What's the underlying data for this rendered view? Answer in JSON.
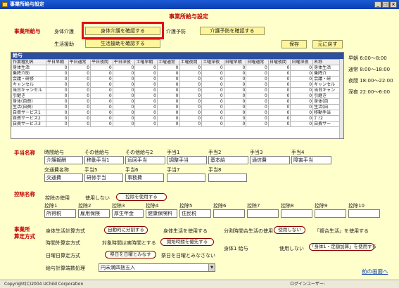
{
  "window": {
    "title": "事業所給与設定"
  },
  "page": {
    "title": "事業所給与設定"
  },
  "jigyosho_kyuyo": {
    "section_label": "事業所給与",
    "kaigo_label": "身体介護",
    "kaigo_button": "身体介護を確認する",
    "kaigo_yobo_label": "介護予防",
    "kaigo_yobo_button": "介護予防を確認する",
    "seikatsu_label": "生活援助",
    "seikatsu_button": "生活援助を確認する",
    "save_button": "保存",
    "back_button": "元に戻す"
  },
  "grid": {
    "title": "給与",
    "columns": [
      "作業種別名",
      "平日早朝",
      "平日通常",
      "平日夜間",
      "平日深夜",
      "土曜早朝",
      "土曜通常",
      "土曜夜間",
      "土曜深夜",
      "日曜早朝",
      "日曜通常",
      "日曜夜間",
      "日曜深夜",
      "名称"
    ],
    "rows": [
      {
        "label": "身体生活",
        "values": [
          0,
          0,
          0,
          0,
          0,
          0,
          0,
          0,
          0,
          0,
          0,
          0
        ],
        "name": "身体生活"
      },
      {
        "label": "乗降介助",
        "values": [
          0,
          0,
          0,
          0,
          0,
          0,
          0,
          0,
          0,
          0,
          0,
          0
        ],
        "name": "乗降介"
      },
      {
        "label": "会議・研修",
        "values": [
          0,
          0,
          0,
          0,
          0,
          0,
          0,
          0,
          0,
          0,
          0,
          0
        ],
        "name": "会議・研"
      },
      {
        "label": "キャンセル",
        "values": [
          0,
          0,
          0,
          0,
          0,
          0,
          0,
          0,
          0,
          0,
          0,
          0
        ],
        "name": "キャンセル"
      },
      {
        "label": "当日キャンセル",
        "values": [
          0,
          0,
          0,
          0,
          0,
          0,
          0,
          0,
          0,
          0,
          0,
          0
        ],
        "name": "当日キャン"
      },
      {
        "label": "引継き",
        "values": [
          0,
          0,
          0,
          0,
          0,
          0,
          0,
          0,
          0,
          0,
          0,
          0
        ],
        "name": "引継き"
      },
      {
        "label": "身体(自費)",
        "values": [
          0,
          0,
          0,
          0,
          0,
          0,
          0,
          0,
          0,
          0,
          0,
          0
        ],
        "name": "身体(自"
      },
      {
        "label": "生活(自費)",
        "values": [
          0,
          0,
          0,
          0,
          0,
          0,
          0,
          0,
          0,
          0,
          0,
          0
        ],
        "name": "生活(自"
      },
      {
        "label": "自費サービス1",
        "values": [
          0,
          0,
          0,
          0,
          0,
          0,
          0,
          0,
          0,
          0,
          0,
          0
        ],
        "name": "移動手当"
      },
      {
        "label": "自費サービス2",
        "values": [
          0,
          0,
          0,
          0,
          0,
          0,
          0,
          0,
          0,
          0,
          0,
          0
        ],
        "name": "ｺﾞﾐ2"
      },
      {
        "label": "自費サービス3",
        "values": [
          0,
          0,
          0,
          0,
          0,
          0,
          0,
          0,
          0,
          0,
          0,
          0
        ],
        "name": "自費サー"
      }
    ]
  },
  "time_slots": [
    "早朝 6:00～8:00",
    "通常 8:00～18:00",
    "夜間 18:00～22:00",
    "深夜 22:00～6:00"
  ],
  "teate": {
    "section_label": "手当名称",
    "labels_row1": [
      "時間給与",
      "その他給与",
      "その他給与2",
      "手当1",
      "手当2",
      "手当3",
      "手当4"
    ],
    "values_row1": [
      "介護報酬",
      "移動手当1",
      "远回手当",
      "調整手当",
      "基本給",
      "通信費",
      "障害手当"
    ],
    "labels_row2": [
      "交通費名称",
      "手当5",
      "手当6",
      "手当7",
      "手当8"
    ],
    "values_row2": [
      "交通費",
      "研修手当",
      "事務費",
      "",
      ""
    ]
  },
  "kojo": {
    "section_label": "控除名称",
    "use_label": "控除の使用",
    "not_use_option": "使用しない",
    "use_option": "控除を使用する",
    "labels": [
      "控除1",
      "控除2",
      "控除3",
      "控除4",
      "控除5",
      "控除6",
      "控除7",
      "控除8",
      "控除9",
      "控除10"
    ],
    "values": [
      "所得税",
      "雇用保険",
      "厚生年金",
      "健康保険料",
      "住民税",
      "",
      "",
      "",
      "",
      ""
    ]
  },
  "hoshiki": {
    "section_label_1": "事業所",
    "section_label_2": "算定方式",
    "shintai_label": "身体生活計算方式",
    "shintai_opt1": "自動的に分割する",
    "shintai_opt2": "身体生活を使用する",
    "bunkatsu_label": "分割時間合生活の使用",
    "bunkatsu_opt1": "使用しない",
    "bunkatsu_opt2": "「複合生活」を使用する",
    "jikangai_label": "時間外算定方式",
    "jikangai_opt1": "対象時間は実時間とする",
    "jikangai_opt2": "開始時間を優先する",
    "shintai1_label": "身体1 給与",
    "shintai1_opt1": "使用しない",
    "shintai1_opt2": "「身体1・定額加算」を使用する",
    "nichiyo_label": "日曜日算定方式",
    "nichiyo_opt1": "祭日を日曜とみなす",
    "nichiyo_opt2": "祭日を日曜とみなさない",
    "hasu_label": "給与計算端数処理",
    "hasu_value": "円未満四捨五入",
    "back_link": "前の画面へ"
  },
  "status": {
    "copyright": "Copyright(C)2004 UChild Corporation",
    "login_user": "ログインユーザー:"
  }
}
